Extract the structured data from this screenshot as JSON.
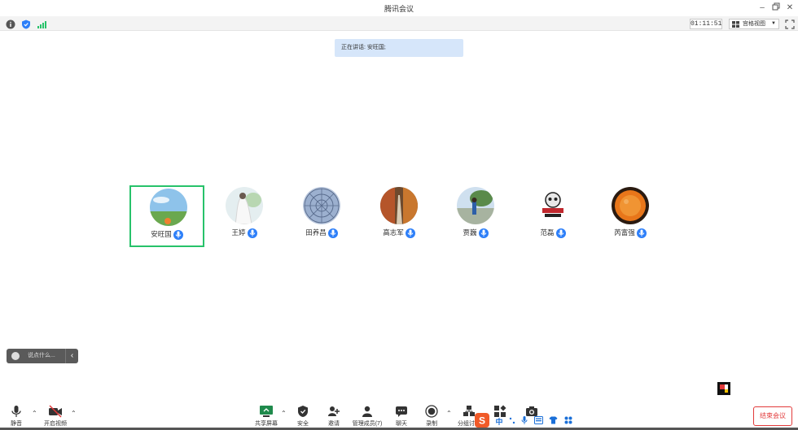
{
  "window": {
    "title": "腾讯会议"
  },
  "status": {
    "timer": "01:11:51",
    "view_mode": "宫格视图"
  },
  "speaking": {
    "text": "正在讲话: 安旺国;"
  },
  "participants": [
    {
      "name": "安旺国",
      "active": true,
      "avatar": "sky-field"
    },
    {
      "name": "王婷",
      "active": false,
      "avatar": "white-dress"
    },
    {
      "name": "田养昌",
      "active": false,
      "avatar": "dome"
    },
    {
      "name": "高志军",
      "active": false,
      "avatar": "autumn-road"
    },
    {
      "name": "贾巍",
      "active": false,
      "avatar": "person-tree"
    },
    {
      "name": "范磊",
      "active": false,
      "avatar": "skull-logo"
    },
    {
      "name": "芮富强",
      "active": false,
      "avatar": "orange-moon"
    }
  ],
  "chat": {
    "placeholder": "说点什么..."
  },
  "toolbar": {
    "mute": "静音",
    "video": "开启视频",
    "share": "共享屏幕",
    "security": "安全",
    "invite": "邀请",
    "members": "管理成员(7)",
    "chat": "聊天",
    "record": "录制",
    "breakout": "分组讨论",
    "end": "结束会议"
  },
  "ime": {
    "label": "中"
  },
  "colors": {
    "accent": "#2d7ff9",
    "active_border": "#27c26a",
    "end": "#e23a3a"
  }
}
